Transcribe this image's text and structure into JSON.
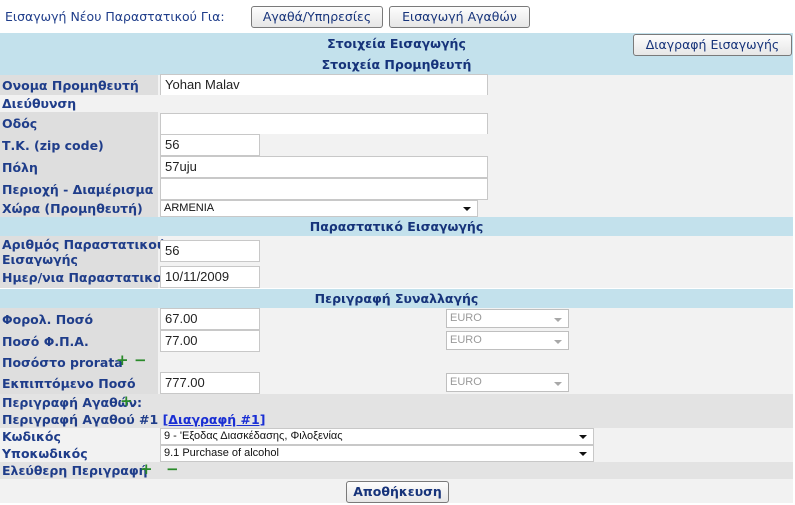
{
  "topbar": {
    "label": "Εισαγωγή Νέου Παραστατικού Για:",
    "btn_goods_services": "Αγαθά/Υπηρεσίες",
    "btn_import_goods": "Εισαγωγή Αγαθών"
  },
  "import_header": {
    "title": "Στοιχεία Εισαγωγής",
    "delete_button": "Διαγραφή Εισαγωγής"
  },
  "supplier": {
    "title": "Στοιχεία Προμηθευτή",
    "name_label": "Ονομα Προμηθευτή",
    "name_value": "Yohan Malav",
    "address_label": "Διεύθυνση",
    "street_label": "Οδός",
    "street_value": "",
    "zip_label": "Τ.Κ. (zip code)",
    "zip_value": "56",
    "city_label": "Πόλη",
    "city_value": "57uju",
    "district_label": "Περιοχή - Διαμέρισμα",
    "district_value": "",
    "country_label": "Χώρα (Προμηθευτή)",
    "country_value": "ARMENIA"
  },
  "document": {
    "title": "Παραστατικό Εισαγωγής",
    "number_label_1": "Αριθμός Παραστατικού",
    "number_label_2": "Εισαγωγής",
    "number_value": "56",
    "date_label": "Ημερ/νια Παραστατικού",
    "date_value": "10/11/2009"
  },
  "transaction": {
    "title": "Περιγραφή Συναλλαγής",
    "taxable_label": "Φορολ. Ποσό",
    "taxable_value": "67.00",
    "taxable_currency": "EURO",
    "vat_label": "Ποσό Φ.Π.Α.",
    "vat_value": "77.00",
    "vat_currency": "EURO",
    "prorata_label": "Ποσόστο prorata",
    "deductible_label": "Εκπιπτόμενο Ποσό",
    "deductible_value": "777.00",
    "deductible_currency": "EURO"
  },
  "goods": {
    "desc_label": "Περιγραφή Αγαθών:",
    "item_label": "Περιγραφή Αγαθού #1",
    "item_delete_link": "[Διαγραφή #1]",
    "code_label": "Κωδικός",
    "code_value": "9 - 'Εξοδας Διασκέδασης, Φιλοξενίας",
    "subcode_label": "Υποκωδικός",
    "subcode_value": "9.1 Purchase of alcohol",
    "free_desc_label": "Ελεύθερη Περιγραφή"
  },
  "icons": {
    "plus": "+",
    "minus": "−"
  },
  "save_button": "Αποθήκευση"
}
